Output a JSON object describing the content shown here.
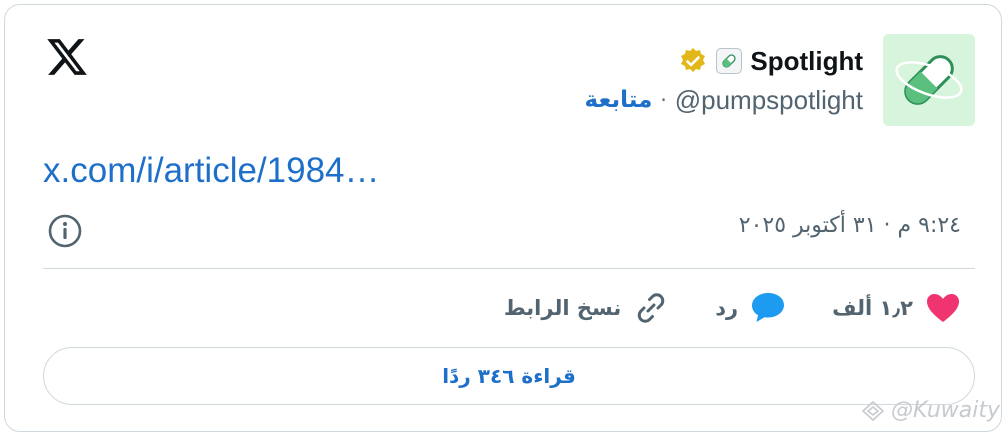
{
  "post": {
    "author_name": "Spotlight",
    "handle": "@pumpspotlight",
    "separator": "·",
    "follow_label": "متابعة",
    "link_text": "x.com/i/article/1984…",
    "timestamp": "٩:٢٤ م · ٣١ أكتوبر ٢٠٢٥"
  },
  "actions": {
    "like_count": "١٫٢ ألف",
    "reply_label": "رد",
    "copy_link_label": "نسخ الرابط"
  },
  "read_replies_label": "قراءة ٣٤٦ ردًا",
  "watermark": "@Kuwaity",
  "icons": {
    "logo": "x-logo-icon",
    "verified": "verified-badge-icon",
    "pill": "pill-emoji-icon",
    "info": "info-icon",
    "like": "heart-icon",
    "reply": "reply-bubble-icon",
    "copy": "link-icon"
  },
  "colors": {
    "accent": "#1d6fc9",
    "heart": "#f0346f",
    "reply": "#1d9bf0",
    "badge": "#e2b719",
    "avatar_bg": "#d6f5dc"
  }
}
